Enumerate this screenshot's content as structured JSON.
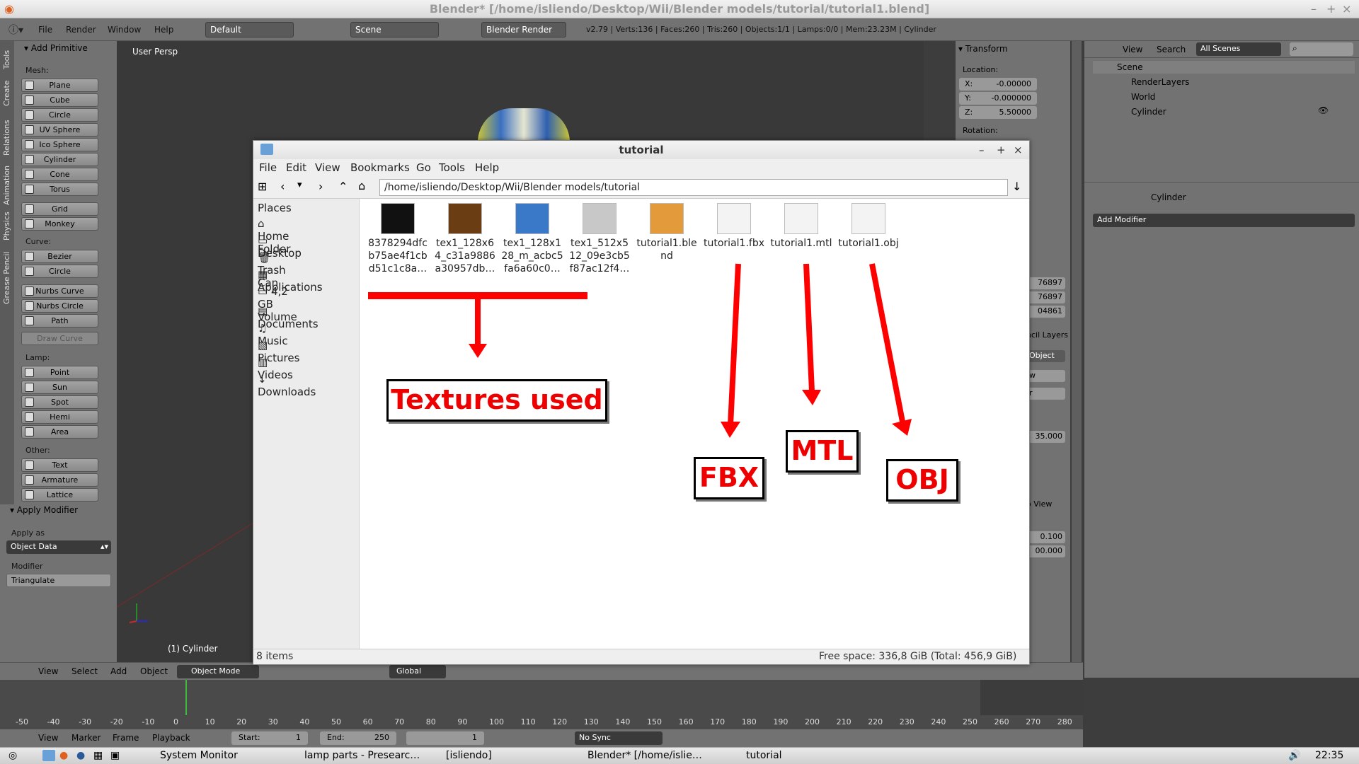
{
  "window_title": "Blender* [/home/isliendo/Desktop/Wii/Blender models/tutorial/tutorial1.blend]",
  "header": {
    "menus": [
      "File",
      "Render",
      "Window",
      "Help"
    ],
    "layout": "Default",
    "scene": "Scene",
    "engine": "Blender Render",
    "stats": "v2.79 | Verts:136 | Faces:260 | Tris:260 | Objects:1/1 | Lamps:0/0 | Mem:23.23M | Cylinder"
  },
  "toolshelf": {
    "tabs": [
      "Tools",
      "Create",
      "Relations",
      "Animation",
      "Physics",
      "Grease Pencil"
    ],
    "title": "Add Primitive",
    "mesh_label": "Mesh:",
    "mesh": [
      "Plane",
      "Cube",
      "Circle",
      "UV Sphere",
      "Ico Sphere",
      "Cylinder",
      "Cone",
      "Torus",
      "Grid",
      "Monkey"
    ],
    "curve_label": "Curve:",
    "curve": [
      "Bezier",
      "Circle",
      "Nurbs Curve",
      "Nurbs Circle",
      "Path"
    ],
    "draw_curve": "Draw Curve",
    "lamp_label": "Lamp:",
    "lamp": [
      "Point",
      "Sun",
      "Spot",
      "Hemi",
      "Area"
    ],
    "other_label": "Other:",
    "other": [
      "Text",
      "Armature",
      "Lattice"
    ],
    "apply_modifier": "Apply Modifier",
    "apply_as_label": "Apply as",
    "apply_as": "Object Data",
    "modifier_label": "Modifier",
    "modifier": "Triangulate"
  },
  "viewport": {
    "persp": "User Persp",
    "object": "(1) Cylinder"
  },
  "npanel": {
    "title": "Transform",
    "location": "Location:",
    "x": "X:",
    "xv": "-0.00000",
    "y": "Y:",
    "yv": "-0.000000",
    "z": "Z:",
    "zv": "5.50000",
    "rotation": "Rotation:",
    "v1": "76897",
    "v2": "76897",
    "v3": "04861",
    "layers": "ncil Layers",
    "obj": "Object",
    "w": "w",
    "r": "r",
    "v4": "35.000",
    "toview": "o View",
    "v5": "0.100",
    "v6": "00.000"
  },
  "outliner": {
    "menus": [
      "View",
      "Search"
    ],
    "filter": "All Scenes",
    "items": [
      "Scene",
      "RenderLayers",
      "World",
      "Cylinder"
    ]
  },
  "props": {
    "object": "Cylinder",
    "add_modifier": "Add Modifier"
  },
  "vp_header": {
    "items": [
      "View",
      "Select",
      "Add",
      "Object"
    ],
    "mode": "Object Mode",
    "orientation": "Global"
  },
  "timeline": {
    "ticks": [
      "-50",
      "-40",
      "-30",
      "-20",
      "-10",
      "0",
      "10",
      "20",
      "30",
      "40",
      "50",
      "60",
      "70",
      "80",
      "90",
      "100",
      "110",
      "120",
      "130",
      "140",
      "150",
      "160",
      "170",
      "180",
      "190",
      "200",
      "210",
      "220",
      "230",
      "240",
      "250",
      "260",
      "270",
      "280"
    ]
  },
  "tl_header": {
    "items": [
      "View",
      "Marker",
      "Frame",
      "Playback"
    ],
    "start": "Start:",
    "start_v": "1",
    "end": "End:",
    "end_v": "250",
    "current": "1",
    "sync": "No Sync"
  },
  "filemanager": {
    "title": "tutorial",
    "menus": [
      "File",
      "Edit",
      "View",
      "Bookmarks",
      "Go",
      "Tools",
      "Help"
    ],
    "path": "/home/isliendo/Desktop/Wii/Blender models/tutorial",
    "places_label": "Places",
    "places": [
      "Home Folder",
      "Desktop",
      "Trash Can",
      "Applications",
      "4,2 GB Volume",
      "Documents",
      "Music",
      "Pictures",
      "Videos",
      "Downloads"
    ],
    "files": [
      {
        "name": "8378294dfc b75ae4f1cb d51c1c8a…",
        "thumb": "#111111"
      },
      {
        "name": "tex1_128x6 4_c31a9886 a30957db…",
        "thumb": "#6b3d12"
      },
      {
        "name": "tex1_128x1 28_m_acbc5 fa6a60c0…",
        "thumb": "#3a78c8"
      },
      {
        "name": "tex1_512x5 12_09e3cb5 f87ac12f4…",
        "thumb": "#c8c8c8"
      },
      {
        "name": "tutorial1.ble nd",
        "thumb": "#e39a3a"
      },
      {
        "name": "tutorial1.fbx",
        "thumb": "#f3f3f3"
      },
      {
        "name": "tutorial1.mtl",
        "thumb": "#f3f3f3"
      },
      {
        "name": "tutorial1.obj",
        "thumb": "#f3f3f3"
      }
    ],
    "status_items": "8 items",
    "status_space": "Free space: 336,8 GiB (Total: 456,9 GiB)"
  },
  "annotations": {
    "textures": "Textures used",
    "fbx": "FBX",
    "mtl": "MTL",
    "obj": "OBJ",
    "color": "#ff0000"
  },
  "taskbar": {
    "apps": [
      "System Monitor",
      "lamp parts - Presearc…",
      "[isliendo]",
      "Blender* [/home/islie…",
      "tutorial"
    ],
    "clock": "22:35"
  }
}
